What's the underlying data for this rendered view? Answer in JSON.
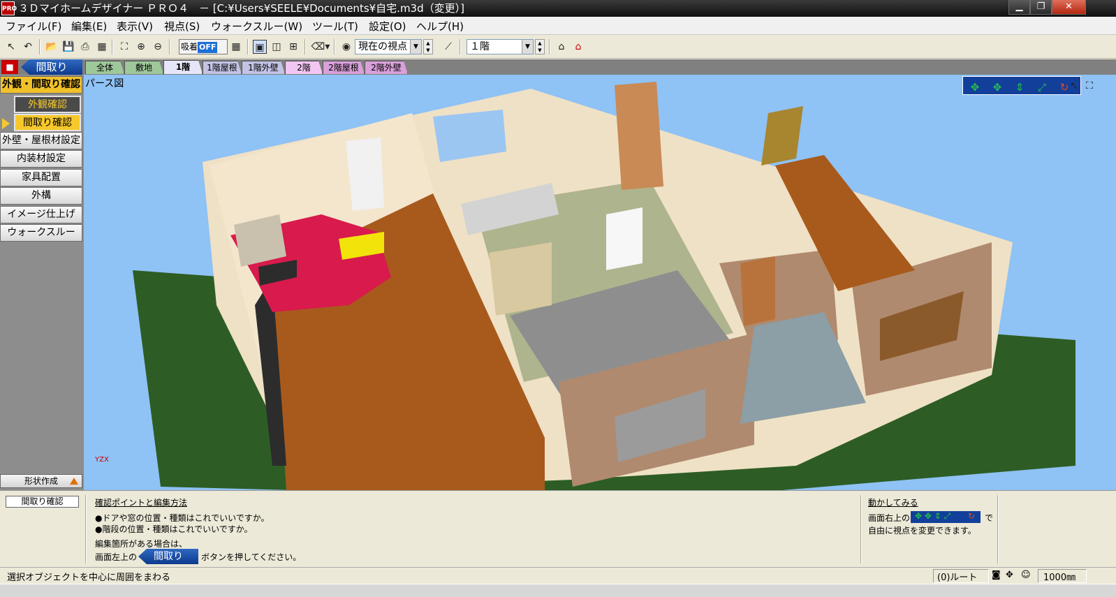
{
  "window": {
    "title": "３Ｄマイホームデザイナー ＰＲＯ４　－ [C:¥Users¥SEELE¥Documents¥自宅.m3d（変更）]",
    "app_icon": "PRO",
    "min": "▁",
    "restore": "❐",
    "close": "✕"
  },
  "menu": [
    "ファイル(F)",
    "編集(E)",
    "表示(V)",
    "視点(S)",
    "ウォークスルー(W)",
    "ツール(T)",
    "設定(O)",
    "ヘルプ(H)"
  ],
  "toolbar": {
    "snap_label": "吸着",
    "snap_state": "OFF",
    "view_combo": "現在の視点",
    "floor_combo": "１階",
    "combo_arrow": "▼",
    "spin_up": "▲",
    "spin_down": "▼"
  },
  "mode_button": "間取り",
  "floor_tabs": [
    "全体",
    "敷地",
    "1階",
    "1階屋根",
    "1階外壁",
    "2階",
    "2階屋根",
    "2階外壁"
  ],
  "sidebar": {
    "header": "外観・間取り確認",
    "sub1": "外観確認",
    "sub2": "間取り確認",
    "items": [
      "外壁・屋根材設定",
      "内装材設定",
      "家具配置",
      "外構",
      "イメージ仕上げ",
      "ウォークスルー"
    ],
    "shape": "形状作成"
  },
  "viewport": {
    "label": "パース図",
    "axis_y": "Y",
    "axis_z": "Z",
    "axis_x": "X"
  },
  "bottom": {
    "mode": "間取り確認",
    "heading": "確認ポイントと編集方法",
    "line1": "●ドアや窓の位置・種類はこれでいいですか。",
    "line2": "●階段の位置・種類はこれでいいですか。",
    "line3": "編集箇所がある場合は、",
    "line4a": "画面左上の",
    "line4btn": "間取り",
    "line4b": "ボタンを押してください。",
    "try_heading": "動かしてみる",
    "try1": "画面右上の",
    "try1b": "で",
    "try2": "自由に視点を変更できます。"
  },
  "status": {
    "message": "選択オブジェクトを中心に周囲をまわる",
    "root": "(0)ルート",
    "scale": "1000㎜"
  },
  "colors": {
    "accent": "#123f9a",
    "sidebar_header": "#f1c12a",
    "floor": "#a85a1c",
    "grass": "#2d5d25",
    "sky": "#8fc2f5"
  }
}
